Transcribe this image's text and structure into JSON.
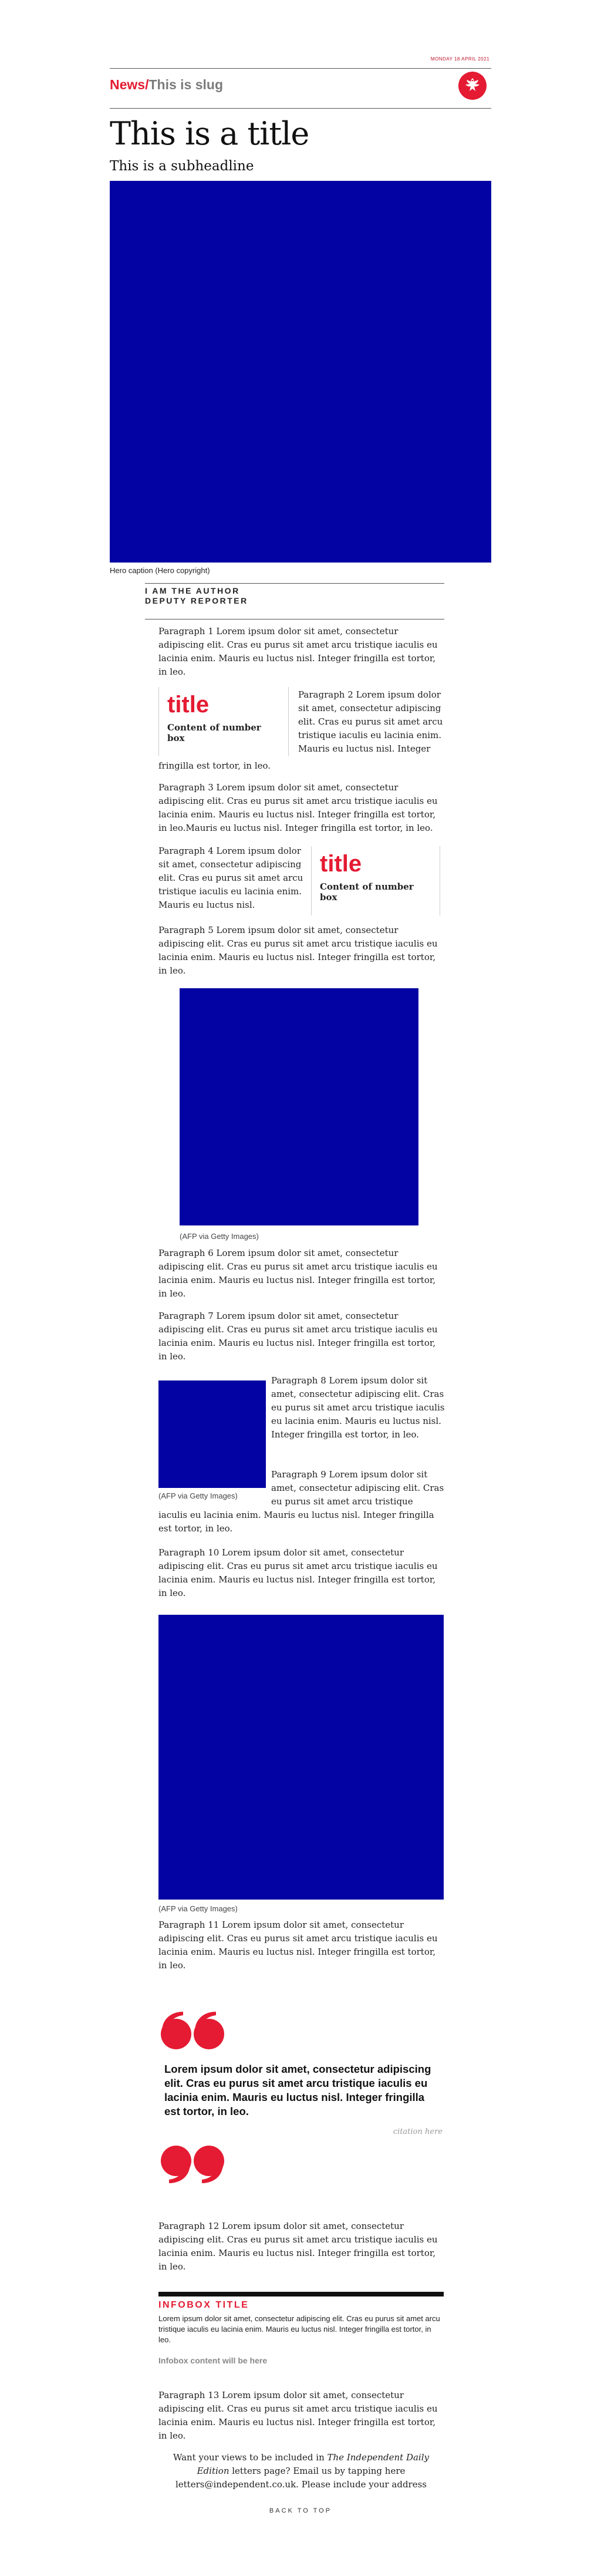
{
  "date": "MONDAY 18 APRIL 2021",
  "header": {
    "section": "News",
    "separator": "/",
    "slug": "This is slug",
    "logo_icon": "eagle-logo-icon",
    "brand_color": "#e41b32"
  },
  "title": "This is a title",
  "subheadline": "This is a subheadline",
  "hero": {
    "caption": "Hero caption (Hero copyright)",
    "color": "#0303a3"
  },
  "author": {
    "name": "I AM THE AUTHOR",
    "role": "DEPUTY REPORTER"
  },
  "paragraphs": {
    "p1": "Paragraph 1 Lorem ipsum dolor sit amet, consectetur adipiscing elit. Cras eu purus sit amet arcu tristique iaculis eu lacinia enim. Mauris eu luctus nisl. Integer fringilla est tortor, in leo.",
    "p2a": "Paragraph 2 Lorem ipsum dolor sit amet, consectetur adipiscing elit. Cras eu purus sit amet arcu tristique iaculis eu lacinia enim. Mauris eu luctus nisl. Integer",
    "p2b": "fringilla est tortor, in leo.",
    "p3": "Paragraph 3 Lorem ipsum dolor sit amet, consectetur adipiscing elit. Cras eu purus sit amet arcu tristique iaculis eu lacinia enim. Mauris eu luctus nisl. Integer fringilla est tortor, in leo.Mauris eu luctus nisl. Integer fringilla est tortor, in leo.",
    "p4": "Paragraph 4 Lorem ipsum dolor sit amet, consectetur adipiscing elit. Cras eu purus sit amet arcu tristique iaculis eu lacinia enim. Mauris eu luctus nisl.",
    "p5": "Paragraph 5 Lorem ipsum dolor sit amet, consectetur adipiscing elit. Cras eu purus sit amet arcu tristique iaculis eu lacinia enim. Mauris eu luctus nisl. Integer fringilla est tortor, in leo.",
    "p6": "Paragraph 6 Lorem ipsum dolor sit amet, consectetur adipiscing elit. Cras eu purus sit amet arcu tristique iaculis eu lacinia enim. Mauris eu luctus nisl. Integer fringilla est tortor, in leo.",
    "p7": "Paragraph 7 Lorem ipsum dolor sit amet, consectetur adipiscing elit. Cras eu purus sit amet arcu tristique iaculis eu lacinia enim. Mauris eu luctus nisl. Integer fringilla est tortor, in leo.",
    "p8": "Paragraph 8 Lorem ipsum dolor sit amet, consectetur adipiscing elit. Cras eu purus sit amet arcu tristique iaculis eu lacinia enim. Mauris eu luctus nisl. Integer fringilla est tortor, in leo.",
    "p9a": "Paragraph 9 Lorem ipsum dolor sit amet, consectetur adipiscing elit. Cras eu purus sit amet arcu tristique",
    "p9b": "iaculis eu lacinia enim. Mauris eu luctus nisl. Integer fringilla est tortor, in leo.",
    "p10": "Paragraph 10 Lorem ipsum dolor sit amet, consectetur adipiscing elit. Cras eu purus sit amet arcu tristique iaculis eu lacinia enim. Mauris eu luctus nisl. Integer fringilla est tortor, in leo.",
    "p11": "Paragraph 11 Lorem ipsum dolor sit amet, consectetur adipiscing elit. Cras eu purus sit amet arcu tristique iaculis eu lacinia enim. Mauris eu luctus nisl. Integer fringilla est tortor, in leo.",
    "p12": "Paragraph 12 Lorem ipsum dolor sit amet, consectetur adipiscing elit. Cras eu purus sit amet arcu tristique iaculis eu lacinia enim. Mauris eu luctus nisl. Integer fringilla est tortor, in leo.",
    "p13": "Paragraph 13 Lorem ipsum dolor sit amet, consectetur adipiscing elit. Cras eu purus sit amet arcu tristique iaculis eu lacinia enim. Mauris eu luctus nisl. Integer fringilla est tortor, in leo."
  },
  "number_box_1": {
    "title": "title",
    "content": "Content of number box"
  },
  "number_box_2": {
    "title": "title",
    "content": "Content of number box"
  },
  "image_captions": {
    "img1": "(AFP via Getty Images)",
    "img2": "(AFP via Getty Images)",
    "img3": "(AFP via Getty Images)"
  },
  "quote": {
    "open_icon": "open-quote-icon",
    "close_icon": "close-quote-icon",
    "text": "Lorem ipsum dolor sit amet, consectetur adipiscing elit. Cras eu purus sit amet arcu tristique iaculis eu lacinia enim. Mauris eu luctus nisl. Integer fringilla est tortor, in leo.",
    "citation": "citation here"
  },
  "infobox": {
    "title": "INFOBOX TITLE",
    "body": "Lorem ipsum dolor sit amet, consectetur adipiscing elit. Cras eu purus sit amet arcu tristique iaculis eu lacinia enim. Mauris eu luctus nisl. Integer fringilla est tortor, in leo.",
    "foot": "Infobox content will be here"
  },
  "letters": {
    "pre": "Want your views to be included in ",
    "publication": "The Independent Daily Edition",
    "post": " letters page? Email us by tapping here letters@independent.co.uk. Please include your address"
  },
  "back_to_top": "BACK TO TOP"
}
